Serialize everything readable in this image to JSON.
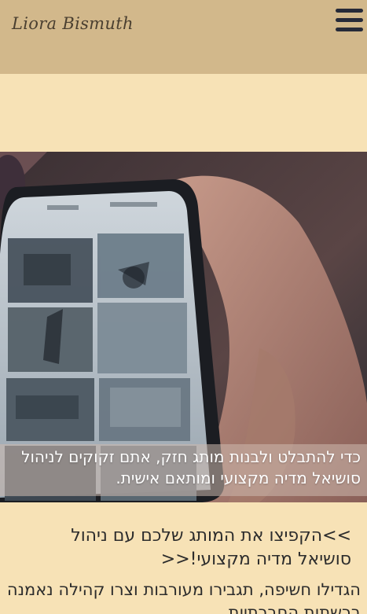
{
  "header": {
    "logo_text": "Liora Bismuth",
    "menu_icon": "hamburger-menu-icon"
  },
  "hero": {
    "image_subject": "hand-holding-smartphone-gallery",
    "caption": "כדי להתבלט ולבנות מותג חזק, אתם זקוקים לניהול סושיאל מדיה מקצועי ומותאם אישית."
  },
  "content": {
    "headline": ">>הקפיצו את המותג שלכם עם ניהול סושיאל מדיה מקצועי!<<",
    "subtext": "הגדילו חשיפה, תגבירו מעורבות וצרו קהילה נאמנה ברשתות החברתיות."
  },
  "colors": {
    "page_background": "#f7e2b6",
    "header_background": "#d2b88b",
    "menu_icon": "#262a38"
  }
}
